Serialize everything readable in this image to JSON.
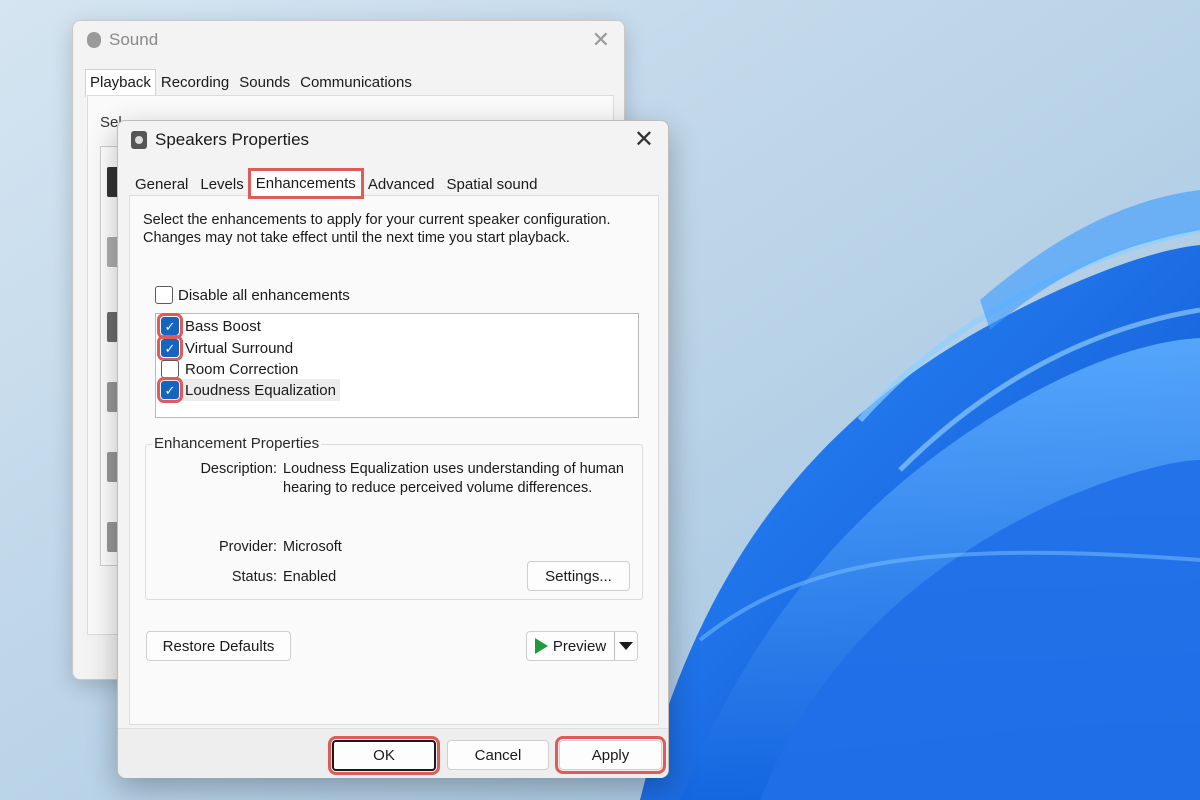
{
  "background_window": {
    "title": "Sound",
    "close_glyph": "✕",
    "tabs": [
      "Playback",
      "Recording",
      "Sounds",
      "Communications"
    ],
    "active_tab": "Playback",
    "partial_description": "Sel"
  },
  "dialog": {
    "title": "Speakers Properties",
    "close_glyph": "✕",
    "tabs": [
      "General",
      "Levels",
      "Enhancements",
      "Advanced",
      "Spatial sound"
    ],
    "active_tab": "Enhancements",
    "instructions": "Select the enhancements to apply for your current speaker configuration. Changes may not take effect until the next time you start playback.",
    "disable_all": {
      "label": "Disable all enhancements",
      "checked": false
    },
    "enhancements": [
      {
        "label": "Bass Boost",
        "checked": true,
        "highlighted": true
      },
      {
        "label": "Virtual Surround",
        "checked": true,
        "highlighted": true
      },
      {
        "label": "Room Correction",
        "checked": false,
        "highlighted": false
      },
      {
        "label": "Loudness Equalization",
        "checked": true,
        "highlighted": true,
        "selected": true
      }
    ],
    "enhancement_properties": {
      "group_label": "Enhancement Properties",
      "description_label": "Description:",
      "description_value": "Loudness Equalization uses understanding of human hearing to reduce perceived volume differences.",
      "provider_label": "Provider:",
      "provider_value": "Microsoft",
      "status_label": "Status:",
      "status_value": "Enabled",
      "settings_button": "Settings..."
    },
    "restore_defaults_button": "Restore Defaults",
    "preview_button": "Preview",
    "buttons": {
      "ok": "OK",
      "cancel": "Cancel",
      "apply": "Apply"
    },
    "highlight_color": "#e05a5a",
    "checkbox_color": "#1565c0"
  }
}
